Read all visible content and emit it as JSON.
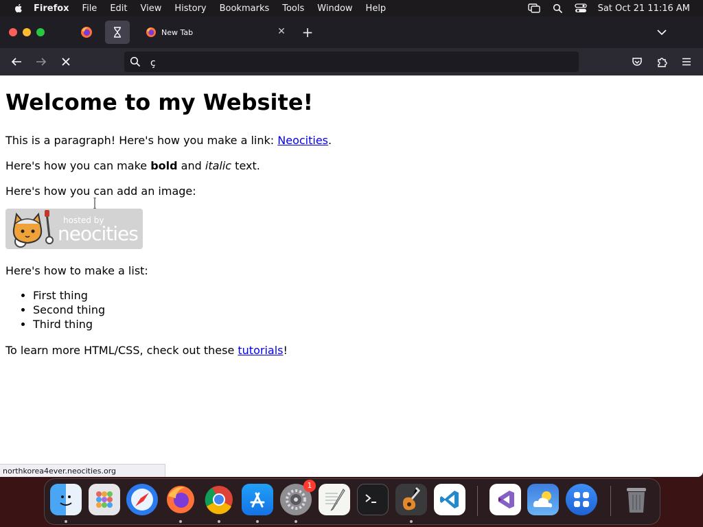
{
  "menubar": {
    "app_name": "Firefox",
    "items": [
      "File",
      "Edit",
      "View",
      "History",
      "Bookmarks",
      "Tools",
      "Window",
      "Help"
    ],
    "clock": "Sat Oct 21  11:16 AM"
  },
  "tabs": {
    "active_title": "New Tab"
  },
  "urlbar": {
    "value": "ç"
  },
  "page": {
    "heading": "Welcome to my Website!",
    "p1_text": "This is a paragraph! Here's how you make a link: ",
    "p1_link": "Neocities",
    "p1_end": ".",
    "p2_a": "Here's how you can make ",
    "p2_bold": "bold",
    "p2_b": " and ",
    "p2_italic": "italic",
    "p2_c": " text.",
    "p3": "Here's how you can add an image:",
    "badge_hosted": "hosted by",
    "badge_brand": "neocities",
    "p4": "Here's how to make a list:",
    "list": [
      "First thing",
      "Second thing",
      "Third thing"
    ],
    "p5_text": "To learn more HTML/CSS, check out these ",
    "p5_link": "tutorials",
    "p5_end": "!"
  },
  "status_url": "northkorea4ever.neocities.org",
  "dock": {
    "settings_badge": "1"
  }
}
